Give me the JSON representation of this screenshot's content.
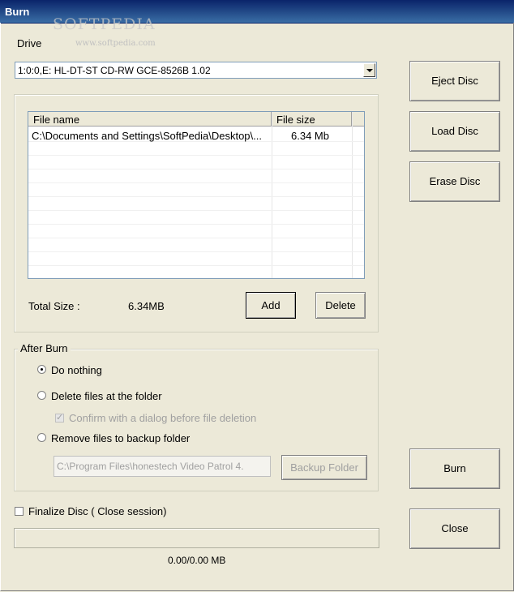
{
  "window": {
    "title": "Burn",
    "watermark": "SOFTPEDIA",
    "watermark_url": "www.softpedia.com"
  },
  "drive": {
    "label": "Drive",
    "selected": "1:0:0,E: HL-DT-ST CD-RW GCE-8526B  1.02"
  },
  "file_list": {
    "columns": [
      "File name",
      "File size"
    ],
    "rows": [
      {
        "name": "C:\\Documents and Settings\\SoftPedia\\Desktop\\...",
        "size": "6.34 Mb"
      }
    ]
  },
  "total": {
    "label": "Total Size :",
    "value": "6.34MB"
  },
  "buttons": {
    "add": "Add",
    "delete": "Delete",
    "eject": "Eject Disc",
    "load": "Load Disc",
    "erase": "Erase Disc",
    "burn": "Burn",
    "close": "Close",
    "backup_folder": "Backup Folder"
  },
  "after_burn": {
    "legend": "After Burn",
    "options": {
      "nothing": "Do nothing",
      "delete_files": "Delete files at the folder",
      "confirm": "Confirm with a dialog before file deletion",
      "remove_backup": "Remove files to backup folder"
    },
    "selected": "Do nothing",
    "backup_path": "C:\\Program Files\\honestech Video Patrol 4."
  },
  "finalize": {
    "label": "Finalize Disc  ( Close session)",
    "checked": false
  },
  "progress": {
    "text": "0.00/0.00 MB",
    "fraction": 0
  },
  "colors": {
    "titlebar": "#0a246a",
    "face": "#ece9d8",
    "border": "#7f9db9"
  }
}
